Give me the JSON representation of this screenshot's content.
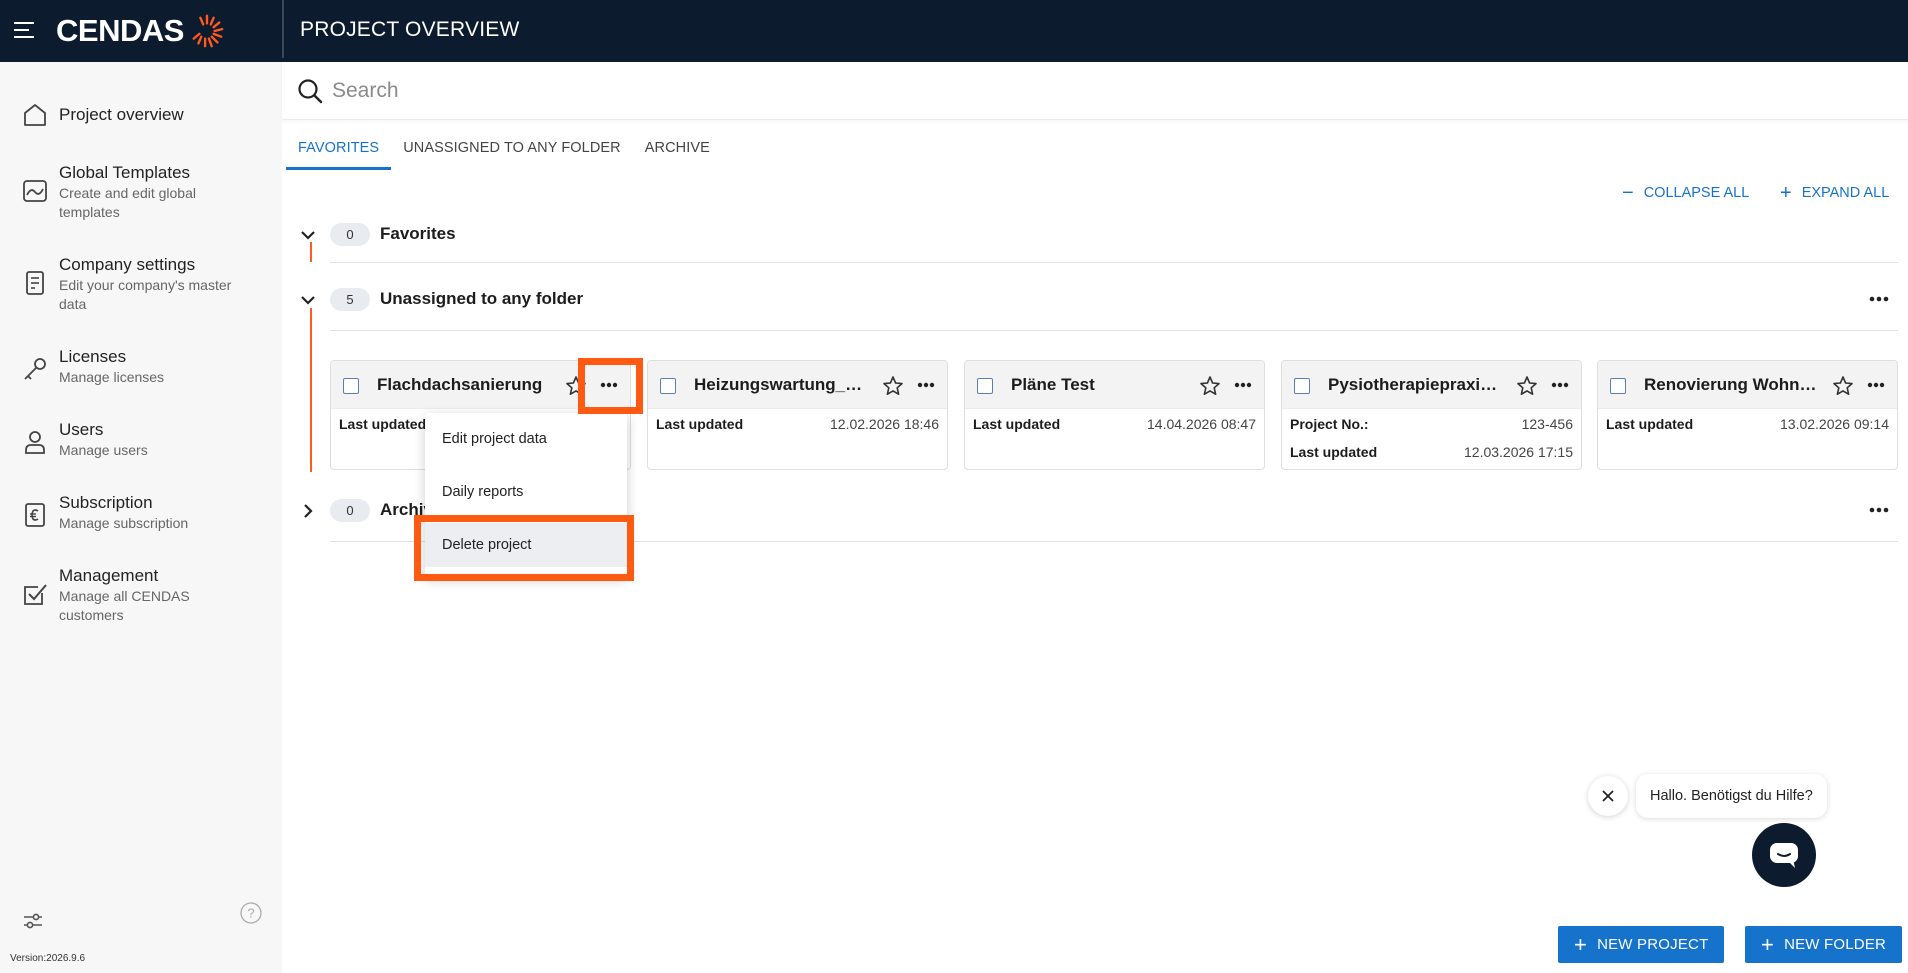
{
  "header": {
    "logo_text": "CENDAS",
    "page_title": "PROJECT OVERVIEW"
  },
  "sidebar": {
    "items": [
      {
        "label": "Project overview",
        "sub": "",
        "icon": "home-icon"
      },
      {
        "label": "Global Templates",
        "sub": "Create and edit global templates",
        "icon": "template-icon"
      },
      {
        "label": "Company settings",
        "sub": "Edit your company's master data",
        "icon": "building-icon"
      },
      {
        "label": "Licenses",
        "sub": "Manage licenses",
        "icon": "key-icon"
      },
      {
        "label": "Users",
        "sub": "Manage users",
        "icon": "user-icon"
      },
      {
        "label": "Subscription",
        "sub": "Manage subscription",
        "icon": "euro-doc-icon"
      },
      {
        "label": "Management",
        "sub": "Manage all CENDAS customers",
        "icon": "checkbox-icon"
      }
    ],
    "version": "Version:2026.9.6"
  },
  "search": {
    "placeholder": "Search",
    "value": ""
  },
  "tabs": [
    {
      "label": "FAVORITES",
      "active": true
    },
    {
      "label": "UNASSIGNED TO ANY FOLDER",
      "active": false
    },
    {
      "label": "ARCHIVE",
      "active": false
    }
  ],
  "toolbar": {
    "collapse_label": "COLLAPSE ALL",
    "expand_label": "EXPAND ALL"
  },
  "groups": [
    {
      "title": "Favorites",
      "count": "0",
      "expanded": true
    },
    {
      "title": "Unassigned to any folder",
      "count": "5",
      "expanded": true
    },
    {
      "title": "Archive",
      "count": "0",
      "expanded": false
    }
  ],
  "projects": [
    {
      "title": "Flachdachsanierung",
      "rows": [
        {
          "k": "Last updated",
          "v": ""
        }
      ]
    },
    {
      "title": "Heizungswartung_H...",
      "rows": [
        {
          "k": "Last updated",
          "v": "12.02.2026 18:46"
        }
      ]
    },
    {
      "title": "Pläne Test",
      "rows": [
        {
          "k": "Last updated",
          "v": "14.04.2026 08:47"
        }
      ]
    },
    {
      "title": "Pysiotherapiepraxis ...",
      "rows": [
        {
          "k": "Project No.:",
          "v": "123-456"
        },
        {
          "k": "Last updated",
          "v": "12.03.2026 17:15"
        }
      ]
    },
    {
      "title": "Renovierung Wohnu...",
      "rows": [
        {
          "k": "Last updated",
          "v": "13.02.2026 09:14"
        }
      ]
    }
  ],
  "context_menu": {
    "items": [
      "Edit project data",
      "Daily reports",
      "Delete project"
    ],
    "hovered": "Delete project"
  },
  "chat": {
    "message": "Hallo. Benötigst du Hilfe?"
  },
  "actions": {
    "new_project": "NEW PROJECT",
    "new_folder": "NEW FOLDER"
  },
  "colors": {
    "navy": "#0d1b2e",
    "accent": "#1673cc",
    "orange": "#ff5a12"
  }
}
